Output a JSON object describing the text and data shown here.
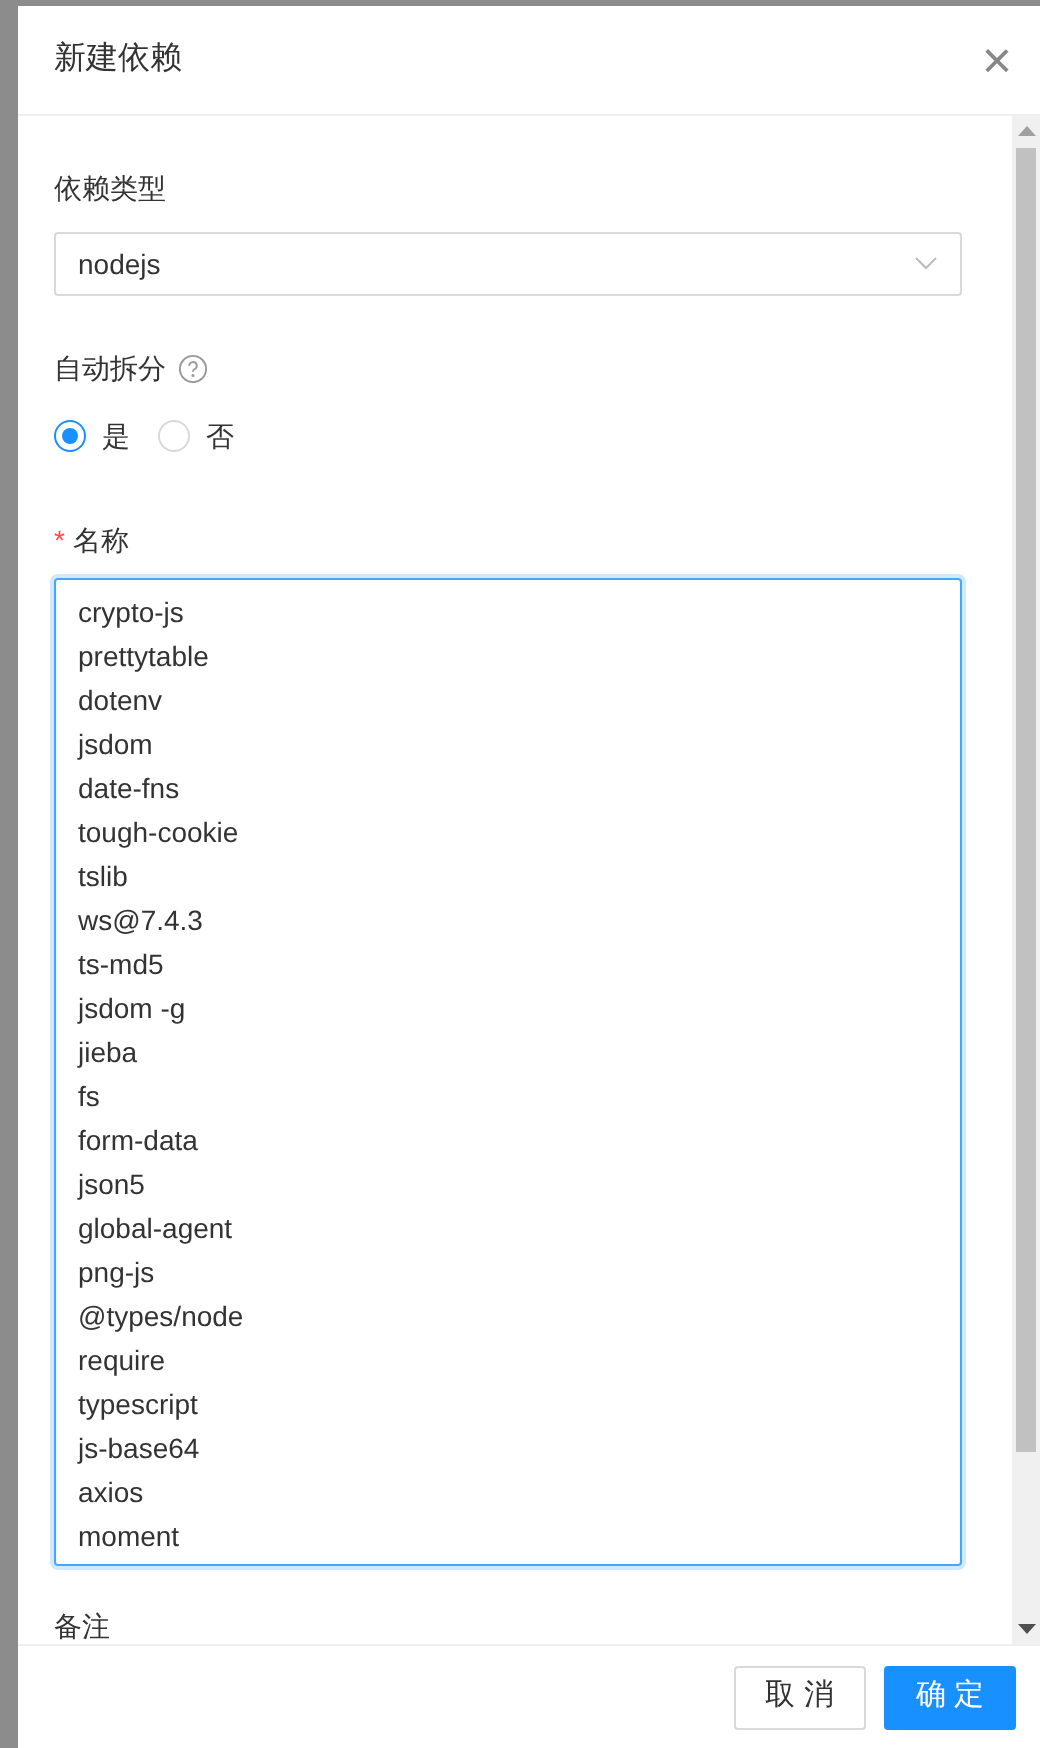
{
  "dialog": {
    "title": "新建依赖",
    "close": "×"
  },
  "form": {
    "type_label": "依赖类型",
    "type_value": "nodejs",
    "split_label": "自动拆分",
    "split_options": [
      {
        "label": "是",
        "selected": true
      },
      {
        "label": "否",
        "selected": false
      }
    ],
    "name_required": "*",
    "name_label": "名称",
    "name_lines": [
      "crypto-js",
      "prettytable",
      "dotenv",
      "jsdom",
      "date-fns",
      "tough-cookie",
      "tslib",
      "ws@7.4.3",
      "ts-md5",
      "jsdom -g",
      "jieba",
      "fs",
      "form-data",
      "json5",
      "global-agent",
      "png-js",
      "@types/node",
      "require",
      "typescript",
      "js-base64",
      "axios",
      "moment"
    ],
    "remark_label": "备注"
  },
  "buttons": [
    {
      "label": "取 消",
      "kind": "default"
    },
    {
      "label": "确 定",
      "kind": "primary"
    }
  ]
}
